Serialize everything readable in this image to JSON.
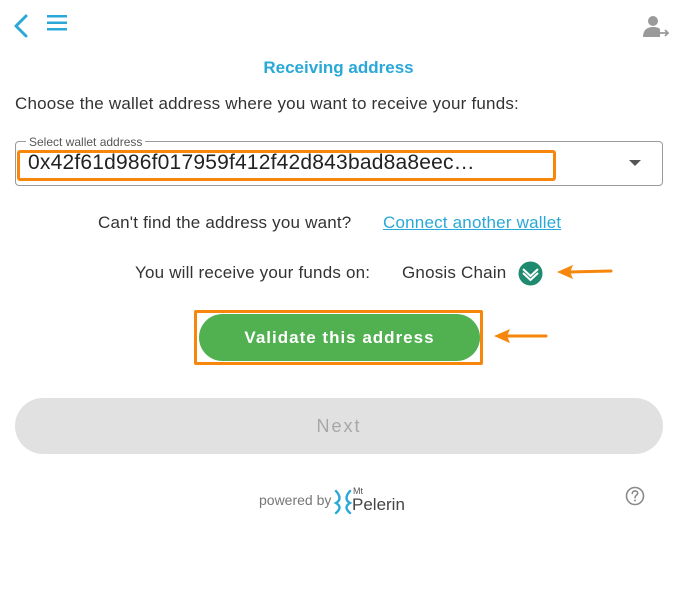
{
  "header": {
    "back_icon": "chevron-left-icon",
    "menu_icon": "hamburger-menu-icon",
    "account_icon": "user-switch-icon",
    "title": "Receiving address"
  },
  "instruction": "Choose the wallet address where you want to receive your funds:",
  "wallet_select": {
    "label": "Select wallet address",
    "value": "0x42f61d986f017959f412f42d843bad8a8eec…"
  },
  "connect": {
    "prompt": "Can't find the address you want?",
    "link_label": "Connect another wallet"
  },
  "network": {
    "label": "You will receive your funds on:",
    "chain_name": "Gnosis Chain",
    "chain_icon": "gnosis-chain-icon"
  },
  "buttons": {
    "validate_label": "Validate this address",
    "next_label": "Next"
  },
  "footer": {
    "powered_by": "powered by",
    "brand_prefix": "Mt",
    "brand_name": "Pelerin",
    "help_icon": "question-circle-icon"
  },
  "colors": {
    "accent": "#2aa8d8",
    "validate_green": "#51b050",
    "annotation_orange": "#f7860d",
    "disabled_gray": "#e1e1e1"
  }
}
